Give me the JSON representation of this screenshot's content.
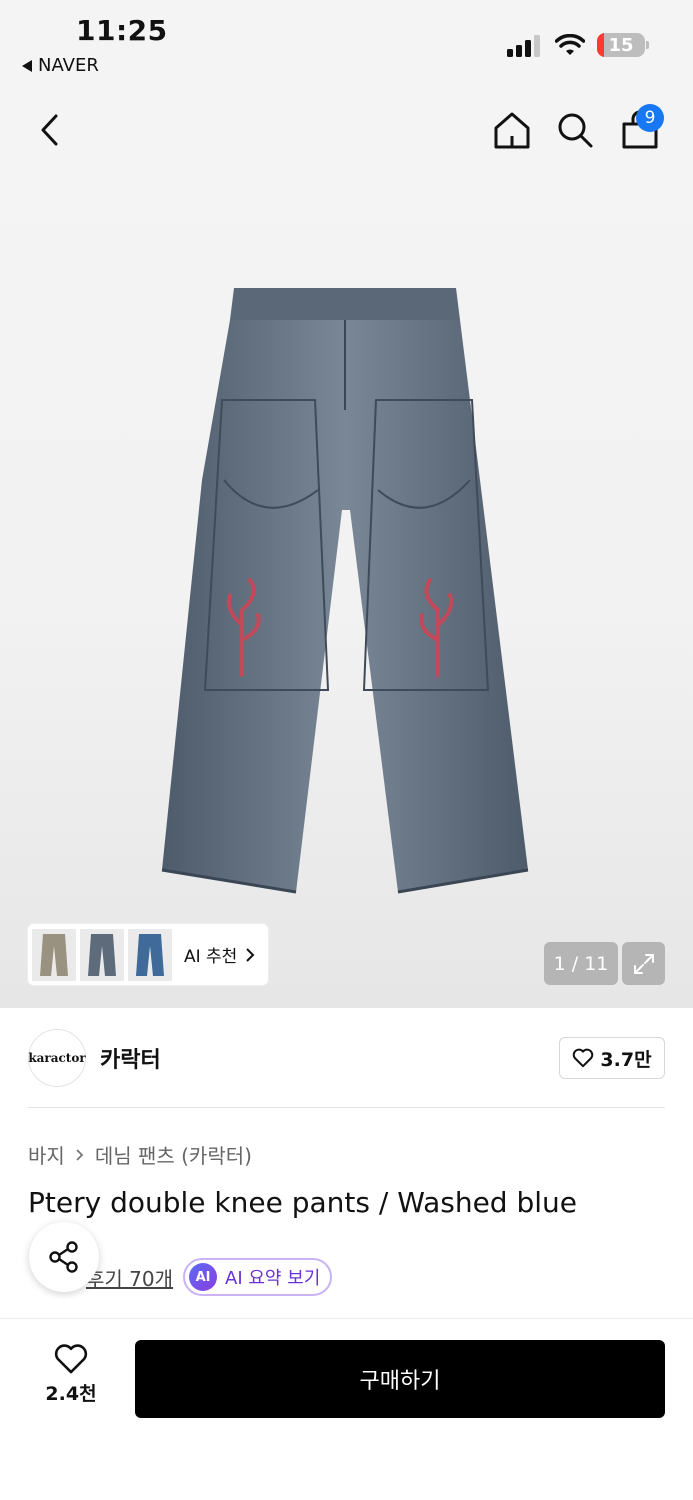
{
  "status_bar": {
    "time": "11:25",
    "back_app": "NAVER",
    "battery": "15",
    "battery_level_percent": 15
  },
  "nav": {
    "cart_count": "9"
  },
  "gallery": {
    "ai_recommend": "AI 추천",
    "page_indicator": "1 / 11"
  },
  "brand": {
    "logo_text": "karactor",
    "name": "카락터",
    "like_count": "3.7만"
  },
  "product": {
    "breadcrumb": [
      "바지",
      "데님 팬츠 (카락터)"
    ],
    "title": "Ptery double knee pants / Washed blue",
    "review_link": "후기 70개",
    "ai_summary_badge": "AI",
    "ai_summary_label": "AI 요약 보기"
  },
  "bottom_bar": {
    "wish_count": "2.4천",
    "buy_label": "구매하기"
  },
  "colors": {
    "accent_blue": "#1877f2",
    "ai_purple": "#6a31d4",
    "battery_red": "#ff3b30",
    "denim": "#5f6f80"
  }
}
